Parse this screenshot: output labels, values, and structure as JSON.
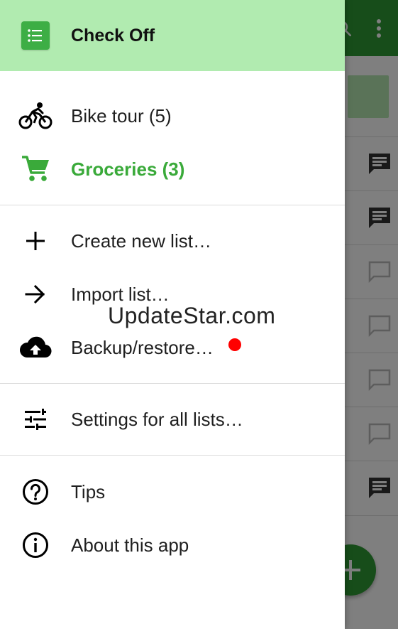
{
  "drawer": {
    "app_title": "Check Off",
    "lists": [
      {
        "label": "Bike tour (5)",
        "icon": "bicycle-icon"
      },
      {
        "label": "Groceries (3)",
        "icon": "shopping-cart-icon",
        "active": true
      }
    ],
    "actions": [
      {
        "label": "Create new list…",
        "icon": "plus-icon"
      },
      {
        "label": "Import list…",
        "icon": "arrow-right-icon"
      },
      {
        "label": "Backup/restore…",
        "icon": "cloud-upload-icon",
        "badge": "red-dot"
      }
    ],
    "settings": [
      {
        "label": "Settings for all lists…",
        "icon": "sliders-icon"
      }
    ],
    "help": [
      {
        "label": "Tips",
        "icon": "help-circle-icon"
      },
      {
        "label": "About this app",
        "icon": "info-circle-icon"
      }
    ]
  },
  "watermark": "UpdateStar.com",
  "colors": {
    "header_bg": "#b1ebb0",
    "accent_green": "#3aaa3a",
    "toolbar_green": "#2e9b34",
    "badge_red": "#ff0000"
  }
}
